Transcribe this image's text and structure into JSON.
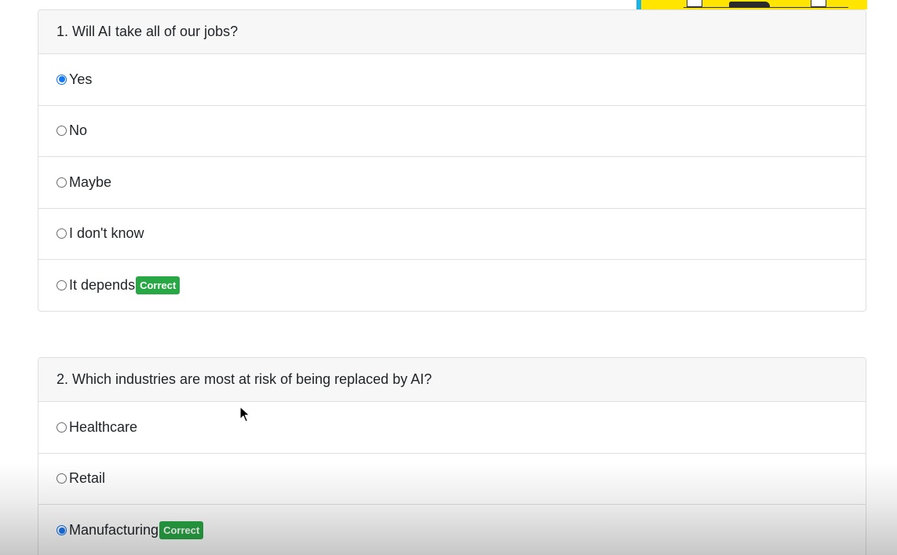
{
  "questions": [
    {
      "title": "1. Will AI take all of our jobs?",
      "options": [
        {
          "label": "Yes",
          "selected": true,
          "badge": ""
        },
        {
          "label": "No",
          "selected": false,
          "badge": ""
        },
        {
          "label": "Maybe",
          "selected": false,
          "badge": ""
        },
        {
          "label": "I don't know",
          "selected": false,
          "badge": ""
        },
        {
          "label": "It depends",
          "selected": false,
          "badge": "Correct"
        }
      ]
    },
    {
      "title": "2. Which industries are most at risk of being replaced by AI?",
      "options": [
        {
          "label": "Healthcare",
          "selected": false,
          "badge": ""
        },
        {
          "label": "Retail",
          "selected": false,
          "badge": ""
        },
        {
          "label": "Manufacturing",
          "selected": true,
          "badge": "Correct"
        }
      ]
    }
  ],
  "colors": {
    "correct_badge": "#28a745",
    "radio_selected": "#1677f2",
    "card_header_bg": "#f7f7f7",
    "banner_yellow": "#ffe500"
  }
}
